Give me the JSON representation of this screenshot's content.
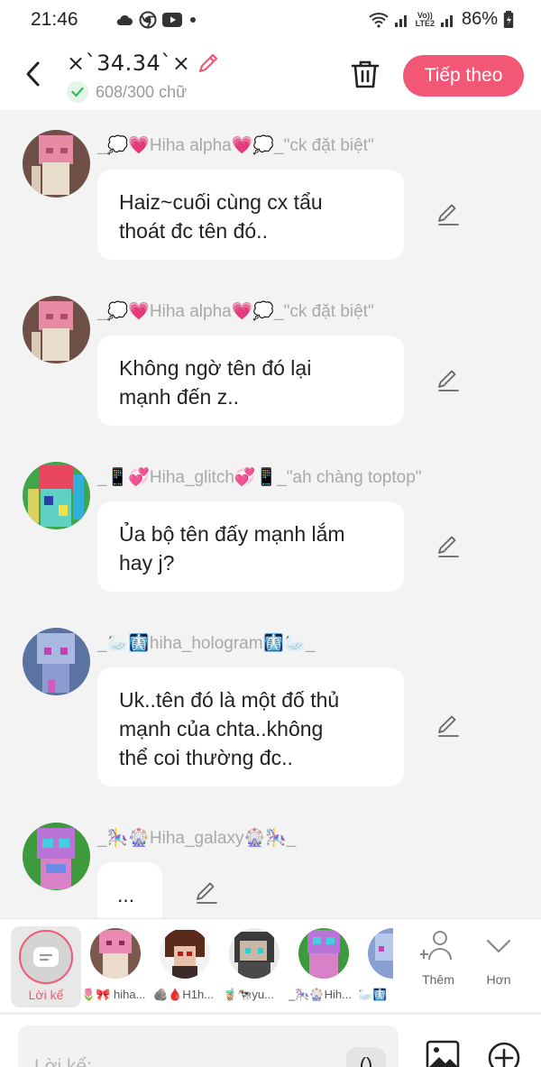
{
  "status_bar": {
    "time": "21:46",
    "battery_pct": "86%",
    "network_label_top": "Vo))",
    "network_label_bottom": "LTE2",
    "icons": [
      "cloud-icon",
      "chrome-icon",
      "youtube-icon",
      "dot-icon",
      "wifi-icon",
      "signal-icon",
      "battery-icon"
    ]
  },
  "header": {
    "title": "×`34.34`×",
    "char_count": "608/300 chữ",
    "next_label": "Tiếp theo"
  },
  "messages": [
    {
      "author": "_💭💗Hiha alpha💗💭_\"ck đặt biệt\"",
      "text_line1": "Haiz~cuối cùng cx tẩu",
      "text_line2": "thoát đc tên đó..",
      "text_line3": ""
    },
    {
      "author": "_💭💗Hiha alpha💗💭_\"ck đặt biệt\"",
      "text_line1": "Không ngờ tên đó lại",
      "text_line2": "mạnh đến z..",
      "text_line3": ""
    },
    {
      "author": "_📱💞Hiha_glitch💞📱_\"ah chàng toptop\"",
      "text_line1": "Ủa bộ tên đấy mạnh lắm",
      "text_line2": "hay j?",
      "text_line3": ""
    },
    {
      "author": "_🦢🩻hiha_hologram🩻🦢_",
      "text_line1": "Uk..tên đó là một đố thủ",
      "text_line2": "mạnh của chta..không",
      "text_line3": "thể coi thường đc.."
    },
    {
      "author": "_🎠🎡Hiha_galaxy🎡🎠_",
      "text_line1": "...",
      "text_line2": "",
      "text_line3": ""
    }
  ],
  "character_bar": {
    "narrator_label": "Lời kể",
    "characters": [
      {
        "name": "🌷🎀 hiha..."
      },
      {
        "name": "🪨🩸H1h..."
      },
      {
        "name": "🧋🐄yu..."
      },
      {
        "name": "_🎠🎡Hih..."
      },
      {
        "name": "🦢🩻"
      }
    ],
    "add_label": "Thêm",
    "more_label": "Hơn"
  },
  "input": {
    "placeholder": "Lời kể:",
    "paren_label": "()"
  },
  "colors": {
    "accent": "#f25776",
    "background": "#f3f3f3",
    "bubble": "#ffffff",
    "muted_text": "#a9a9a9"
  }
}
